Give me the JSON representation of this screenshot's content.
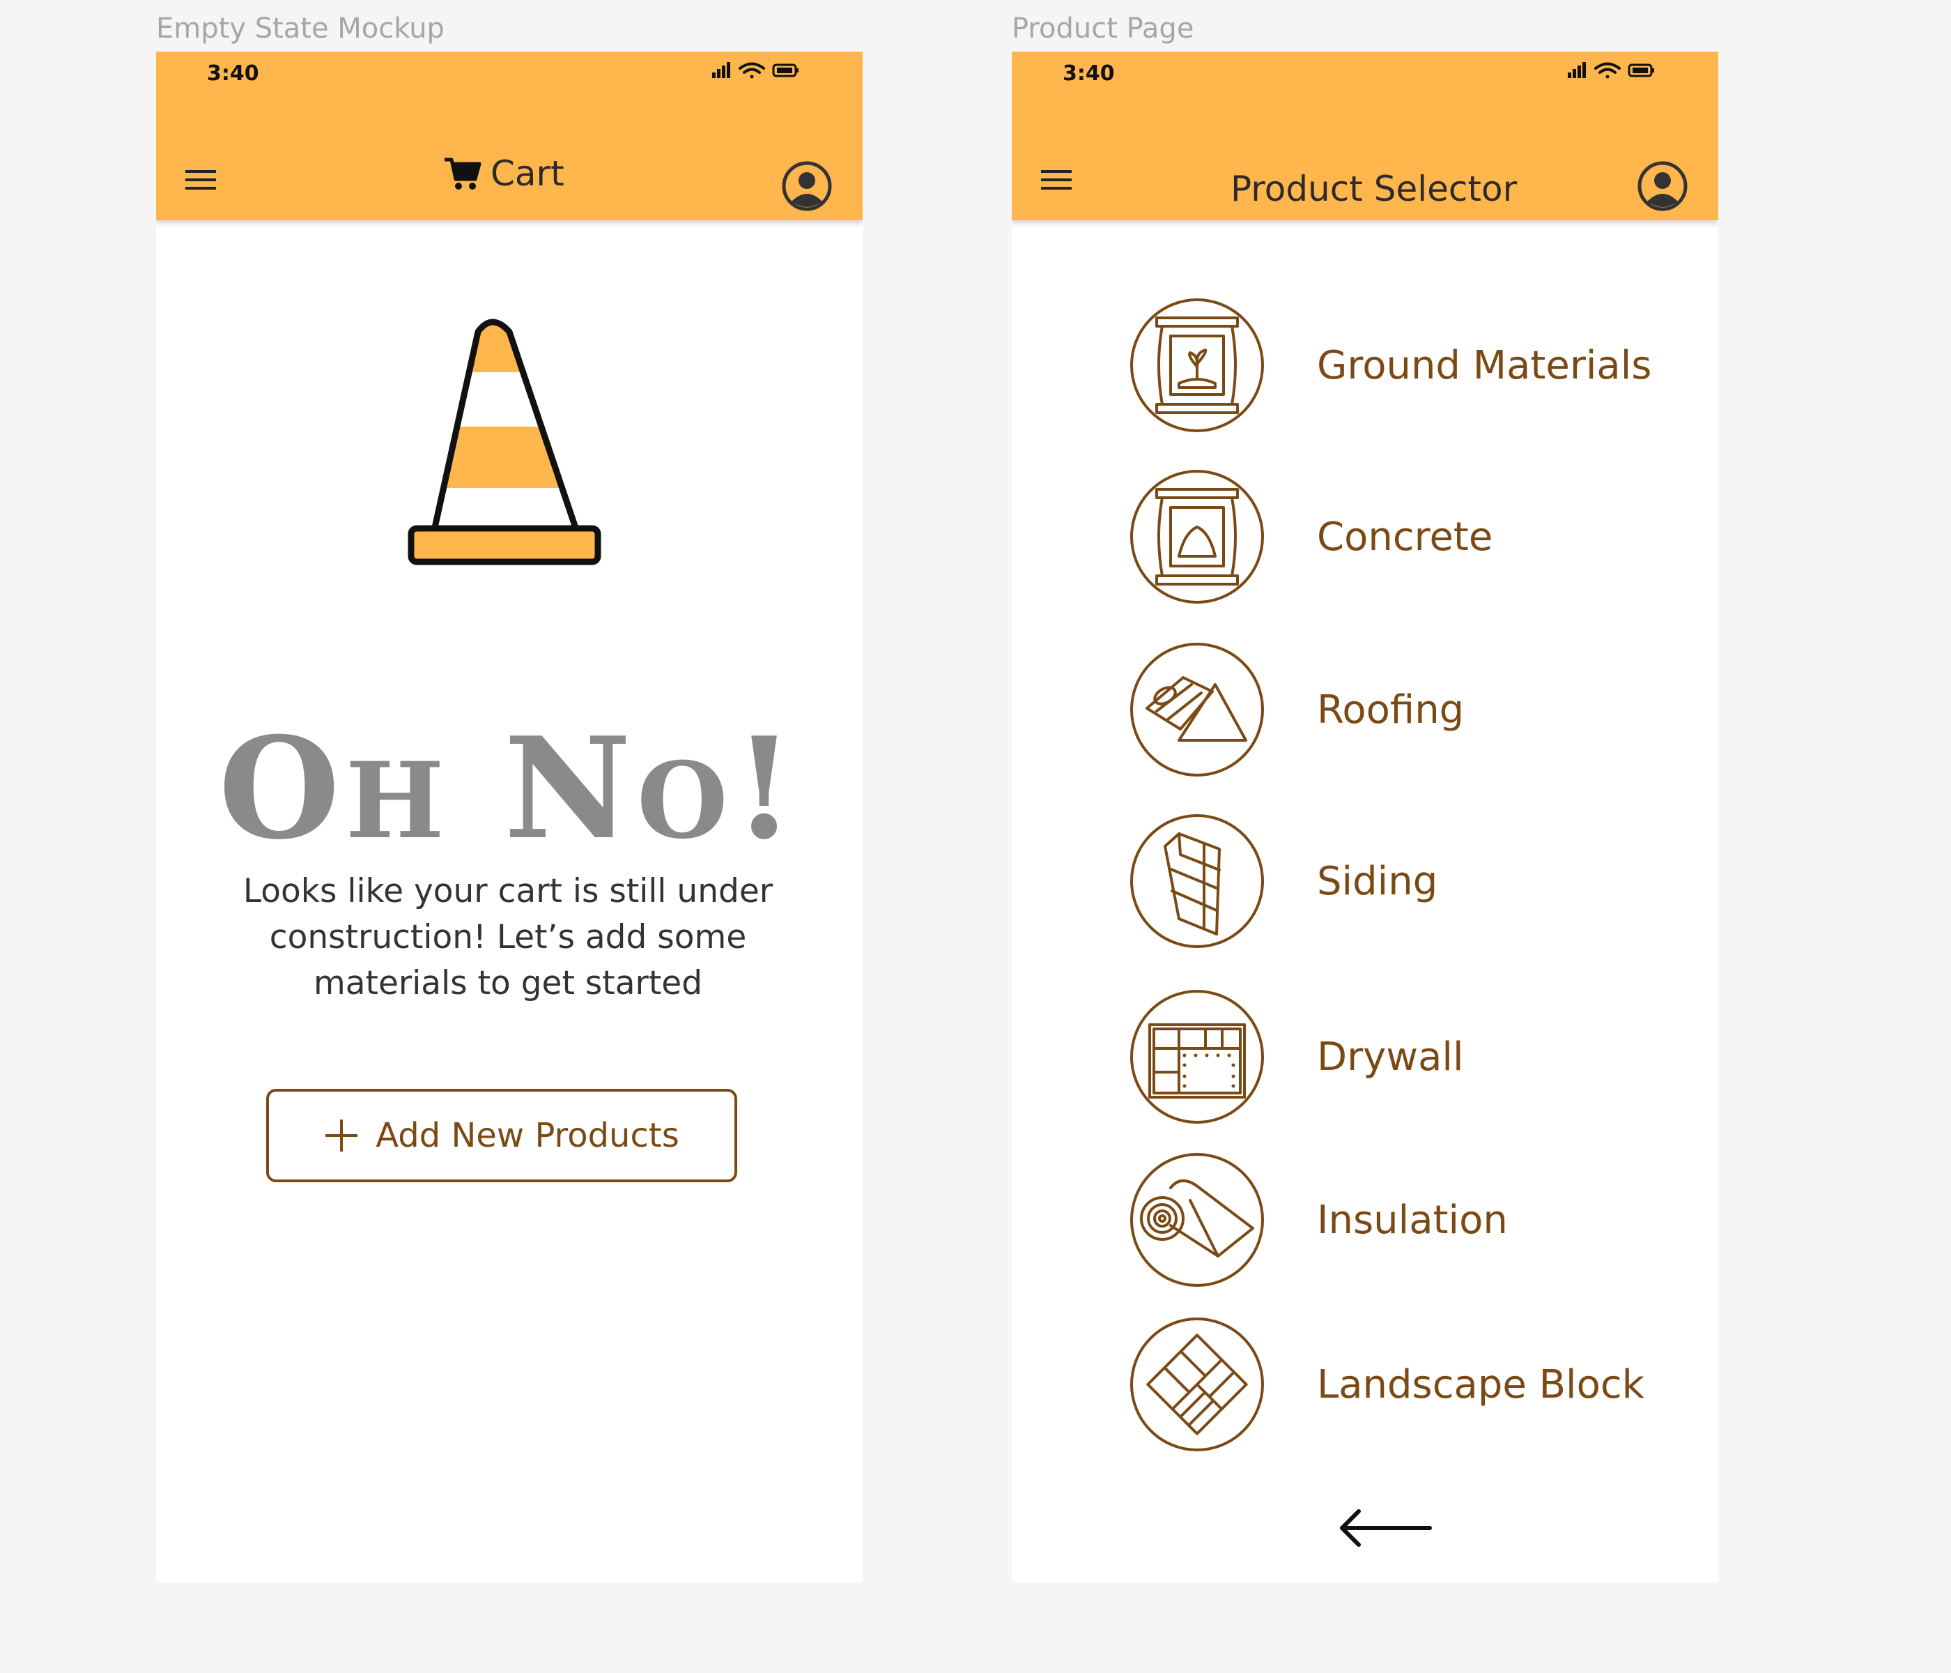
{
  "frames": {
    "empty_label": "Empty State Mockup",
    "product_label": "Product Page"
  },
  "empty_phone": {
    "time": "3:40",
    "title": "Cart",
    "heading": "Oh No!",
    "heading_O": "O",
    "heading_h": "H",
    "heading_N": "N",
    "heading_o": "O",
    "heading_bang": "!",
    "message": "Looks like your cart is still under construction! Let’s add some materials to get started",
    "button_label": "Add New Products",
    "icons": [
      "signal-icon",
      "wifi-icon",
      "battery-icon",
      "menu-icon",
      "cart-icon",
      "account-icon",
      "traffic-cone-icon",
      "plus-icon"
    ]
  },
  "product_phone": {
    "time": "3:40",
    "title": "Product Selector",
    "products": [
      {
        "label": "Ground Materials",
        "icon": "soil-bag-icon"
      },
      {
        "label": "Concrete",
        "icon": "concrete-bag-icon"
      },
      {
        "label": "Roofing",
        "icon": "roofing-icon"
      },
      {
        "label": "Siding",
        "icon": "siding-icon"
      },
      {
        "label": "Drywall",
        "icon": "drywall-icon"
      },
      {
        "label": "Insulation",
        "icon": "insulation-roll-icon"
      },
      {
        "label": "Landscape Block",
        "icon": "landscape-block-icon"
      }
    ],
    "icons": [
      "signal-icon",
      "wifi-icon",
      "battery-icon",
      "menu-icon",
      "account-icon",
      "back-arrow-icon"
    ]
  },
  "colors": {
    "appbar": "#FFB74D",
    "accent_brown": "#7B4A14",
    "heading_gray": "#8a8a8a",
    "background": "#f5f5f5"
  }
}
